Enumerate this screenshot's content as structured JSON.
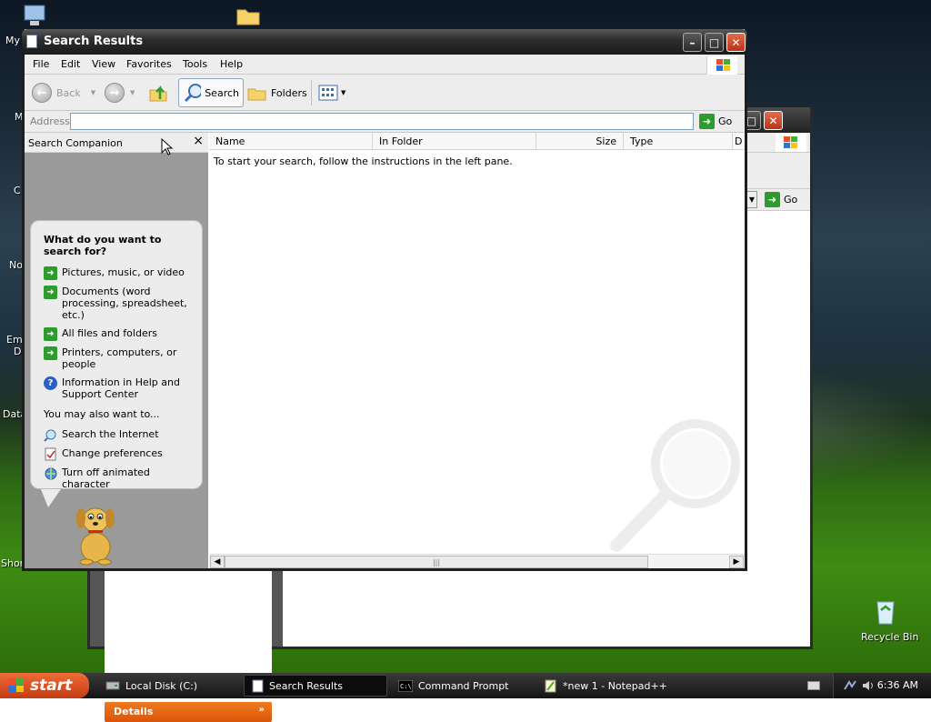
{
  "desktop": {
    "icon_labels": [
      "My",
      "M",
      "C",
      "No",
      "Em",
      "D",
      "Data",
      "Shor"
    ],
    "recycle_bin_label": "Recycle Bin"
  },
  "background_window": {
    "go_label": "Go",
    "details_label": "Details"
  },
  "window": {
    "title": "Search Results",
    "menu": [
      "File",
      "Edit",
      "View",
      "Favorites",
      "Tools",
      "Help"
    ],
    "toolbar": {
      "back_label": "Back",
      "search_label": "Search",
      "folders_label": "Folders"
    },
    "address": {
      "label": "Address",
      "value": "",
      "go_label": "Go"
    }
  },
  "search_companion": {
    "title": "Search Companion",
    "question": "What do you want to search for?",
    "options": [
      "Pictures, music, or video",
      "Documents (word processing, spreadsheet, etc.)",
      "All files and folders",
      "Printers, computers, or people",
      "Information in Help and Support Center"
    ],
    "also_label": "You may also want to...",
    "also_options": [
      "Search the Internet",
      "Change preferences",
      "Turn off animated character"
    ]
  },
  "results": {
    "columns": [
      "Name",
      "In Folder",
      "Size",
      "Type",
      "D"
    ],
    "hint": "To start your search, follow the instructions in the left pane."
  },
  "taskbar": {
    "start_label": "start",
    "tasks": [
      "Local Disk (C:)",
      "Search Results",
      "Command Prompt",
      "*new 1 - Notepad++"
    ],
    "clock": "6:36 AM"
  }
}
